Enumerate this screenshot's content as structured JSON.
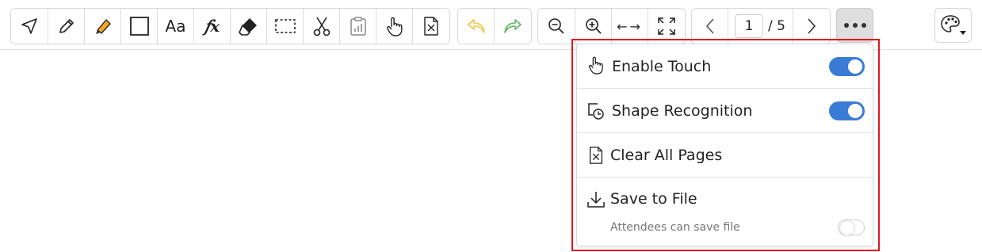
{
  "toolbar": {
    "tools": [
      {
        "icon": "select-arrow-icon"
      },
      {
        "icon": "pencil-icon"
      },
      {
        "icon": "highlighter-icon",
        "color": "#f5a623"
      },
      {
        "icon": "rectangle-icon"
      },
      {
        "icon": "text-icon",
        "label": "Aa"
      },
      {
        "icon": "formula-icon",
        "label": "𝑓x"
      },
      {
        "icon": "eraser-icon"
      },
      {
        "icon": "selection-marquee-icon"
      },
      {
        "icon": "scissors-icon"
      },
      {
        "icon": "clipboard-chart-icon"
      },
      {
        "icon": "hand-pointer-icon"
      },
      {
        "icon": "clear-file-icon"
      }
    ],
    "undo_icon": "undo-icon",
    "redo_icon": "redo-icon",
    "undo_color": "#f5c242",
    "redo_color": "#5cb85c",
    "zoom": {
      "zoom_out_icon": "zoom-out-icon",
      "zoom_in_icon": "zoom-in-icon",
      "fit_width_label": "←→",
      "fullscreen_icon": "fullscreen-icon"
    },
    "pager": {
      "current": "1",
      "total": "/ 5"
    },
    "more_icon": "more-dots-icon",
    "palette_icon": "palette-icon"
  },
  "menu": {
    "items": [
      {
        "label": "Enable Touch",
        "icon": "hand-pointer-icon",
        "toggle": true
      },
      {
        "label": "Shape Recognition",
        "icon": "shape-recognition-icon",
        "toggle": true
      },
      {
        "label": "Clear All Pages",
        "icon": "clear-file-icon"
      },
      {
        "label": "Save to File",
        "icon": "download-icon"
      }
    ],
    "sub_option": {
      "label": "Attendees can save file",
      "toggle": false
    },
    "toggle_on_color": "#3a7bd5",
    "highlight_color": "#e0161c"
  }
}
